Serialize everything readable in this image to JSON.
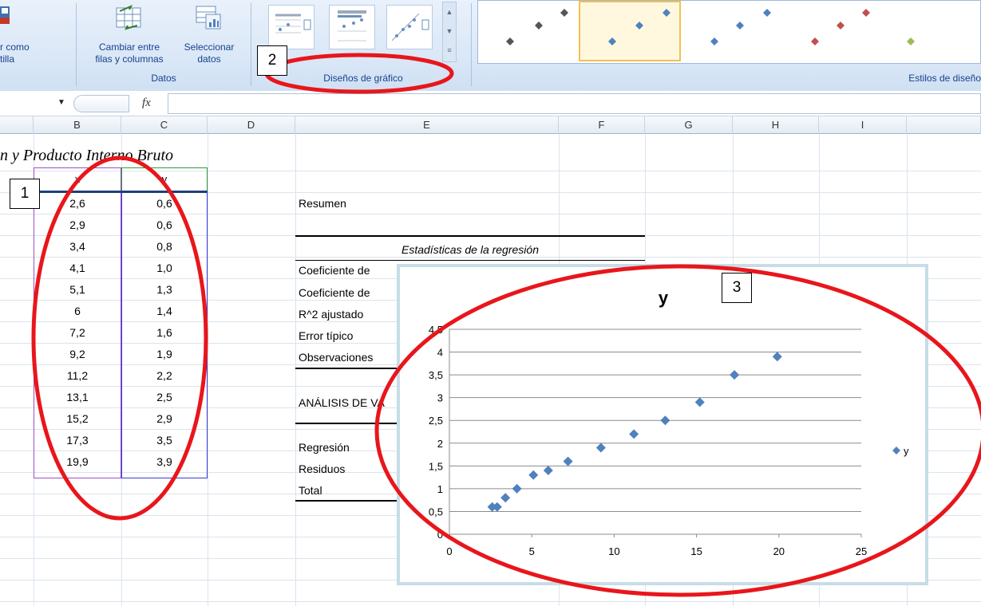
{
  "ribbon": {
    "btn_save_as_template": [
      "r como",
      "tilla"
    ],
    "btn_switch_row_col": [
      "Cambiar entre",
      "filas y columnas"
    ],
    "btn_select_data": [
      "Seleccionar",
      "datos"
    ],
    "group_data": "Datos",
    "group_layouts": "Diseños de gráfico",
    "group_styles": "Estilos de diseño"
  },
  "formula_bar": {
    "fx_label": "fx",
    "value": ""
  },
  "columns": [
    "B",
    "C",
    "D",
    "E",
    "F",
    "G",
    "H",
    "I"
  ],
  "sheet_title": "n y Producto Interno Bruto",
  "table": {
    "headers": [
      "x",
      "y"
    ],
    "rows": [
      [
        "2,6",
        "0,6"
      ],
      [
        "2,9",
        "0,6"
      ],
      [
        "3,4",
        "0,8"
      ],
      [
        "4,1",
        "1,0"
      ],
      [
        "5,1",
        "1,3"
      ],
      [
        "6",
        "1,4"
      ],
      [
        "7,2",
        "1,6"
      ],
      [
        "9,2",
        "1,9"
      ],
      [
        "11,2",
        "2,2"
      ],
      [
        "13,1",
        "2,5"
      ],
      [
        "15,2",
        "2,9"
      ],
      [
        "17,3",
        "3,5"
      ],
      [
        "19,9",
        "3,9"
      ]
    ]
  },
  "summary": {
    "resumen": "Resumen",
    "stats_title": "Estadísticas de la regresión",
    "labels": [
      "Coeficiente de",
      "Coeficiente de",
      "R^2  ajustado",
      "Error típico",
      "Observaciones"
    ],
    "anova_title": "ANÁLISIS DE VA",
    "anova_rows": [
      "Regresión",
      "Residuos",
      "Total"
    ]
  },
  "callouts": [
    "1",
    "2",
    "3"
  ],
  "chart_data": {
    "type": "scatter",
    "title": "y",
    "series": [
      {
        "name": "y",
        "x": [
          2.6,
          2.9,
          3.4,
          4.1,
          5.1,
          6,
          7.2,
          9.2,
          11.2,
          13.1,
          15.2,
          17.3,
          19.9
        ],
        "y": [
          0.6,
          0.6,
          0.8,
          1.0,
          1.3,
          1.4,
          1.6,
          1.9,
          2.2,
          2.5,
          2.9,
          3.5,
          3.9
        ]
      }
    ],
    "xlim": [
      0,
      25
    ],
    "ylim": [
      0,
      4.5
    ],
    "xticks": [
      "0",
      "5",
      "10",
      "15",
      "20",
      "25"
    ],
    "yticks": [
      "0",
      "0,5",
      "1",
      "1,5",
      "2",
      "2,5",
      "3",
      "3,5",
      "4",
      "4,5"
    ],
    "legend": "right",
    "grid": "horizontal",
    "marker_color": "#4f81bd"
  },
  "colors": {
    "annotation_red": "#e8161b",
    "ribbon_text": "#15428b"
  }
}
